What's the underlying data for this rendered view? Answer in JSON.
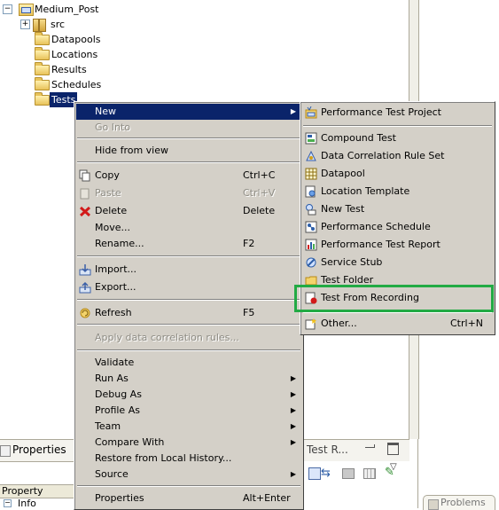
{
  "tree": {
    "project": "Medium_Post",
    "items": [
      {
        "label": "src",
        "kind": "package"
      },
      {
        "label": "Datapools",
        "kind": "folder"
      },
      {
        "label": "Locations",
        "kind": "folder"
      },
      {
        "label": "Results",
        "kind": "folder"
      },
      {
        "label": "Schedules",
        "kind": "folder"
      },
      {
        "label": "Tests",
        "kind": "folder",
        "selected": true
      }
    ]
  },
  "context_menu": {
    "items": [
      {
        "label": "New",
        "submenu": true,
        "highlighted": true
      },
      {
        "label": "Go Into",
        "disabled": true
      },
      {
        "label": "Hide from view"
      },
      {
        "label": "Copy",
        "shortcut": "Ctrl+C",
        "icon": "copy-icon"
      },
      {
        "label": "Paste",
        "shortcut": "Ctrl+V",
        "disabled": true,
        "icon": "paste-icon"
      },
      {
        "label": "Delete",
        "shortcut": "Delete",
        "icon": "delete-icon"
      },
      {
        "label": "Move..."
      },
      {
        "label": "Rename...",
        "shortcut": "F2"
      },
      {
        "label": "Import...",
        "icon": "import-icon"
      },
      {
        "label": "Export...",
        "icon": "export-icon"
      },
      {
        "label": "Refresh",
        "shortcut": "F5",
        "icon": "refresh-icon"
      },
      {
        "label": "Apply data correlation rules...",
        "disabled": true
      },
      {
        "label": "Validate"
      },
      {
        "label": "Run As",
        "submenu": true
      },
      {
        "label": "Debug As",
        "submenu": true
      },
      {
        "label": "Profile As",
        "submenu": true
      },
      {
        "label": "Team",
        "submenu": true
      },
      {
        "label": "Compare With",
        "submenu": true
      },
      {
        "label": "Restore from Local History..."
      },
      {
        "label": "Source",
        "submenu": true
      },
      {
        "label": "Properties",
        "shortcut": "Alt+Enter"
      }
    ]
  },
  "new_submenu": {
    "items": [
      {
        "label": "Performance Test Project",
        "icon": "performance-test-project-icon"
      },
      {
        "label": "Compound Test",
        "icon": "compound-test-icon"
      },
      {
        "label": "Data Correlation Rule Set",
        "icon": "rule-set-icon"
      },
      {
        "label": "Datapool",
        "icon": "datapool-icon"
      },
      {
        "label": "Location Template",
        "icon": "location-template-icon"
      },
      {
        "label": "New Test",
        "icon": "new-test-icon"
      },
      {
        "label": "Performance Schedule",
        "icon": "schedule-icon"
      },
      {
        "label": "Performance Test Report",
        "icon": "report-icon"
      },
      {
        "label": "Service Stub",
        "icon": "service-stub-icon"
      },
      {
        "label": "Test Folder",
        "icon": "test-folder-icon"
      },
      {
        "label": "Test From Recording",
        "icon": "recording-icon"
      },
      {
        "label": "Other...",
        "shortcut": "Ctrl+N",
        "icon": "other-wizard-icon"
      }
    ]
  },
  "bottom": {
    "properties_tab": "Properties",
    "test_tab": "Test R...",
    "property_header": "Property",
    "info_row": "Info",
    "problems_tab": "Problems"
  },
  "colors": {
    "menu_bg": "#d4d0c8",
    "highlight": "#0a246a",
    "recording_outline": "#22aa44"
  }
}
